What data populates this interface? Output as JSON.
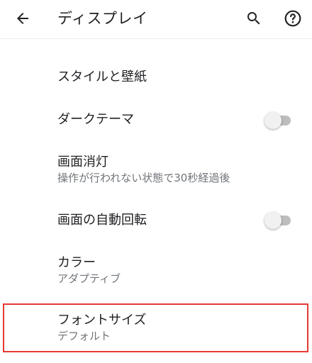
{
  "header": {
    "title": "ディスプレイ",
    "back_icon": "arrow-back-icon",
    "search_icon": "search-icon",
    "help_icon": "help-circle-icon"
  },
  "settings": {
    "style_wallpaper": {
      "label": "スタイルと壁紙"
    },
    "dark_theme": {
      "label": "ダークテーマ",
      "enabled": false
    },
    "screen_timeout": {
      "label": "画面消灯",
      "summary": "操作が行われない状態で30秒経過後"
    },
    "auto_rotate": {
      "label": "画面の自動回転",
      "enabled": false
    },
    "color": {
      "label": "カラー",
      "summary": "アダプティブ"
    },
    "font_size": {
      "label": "フォントサイズ",
      "summary": "デフォルト"
    }
  },
  "colors": {
    "highlight_border": "#e53935",
    "toggle_track_off": "#bdbdbd",
    "toggle_thumb_off": "#f1f1f1",
    "secondary_text": "#70757a"
  }
}
